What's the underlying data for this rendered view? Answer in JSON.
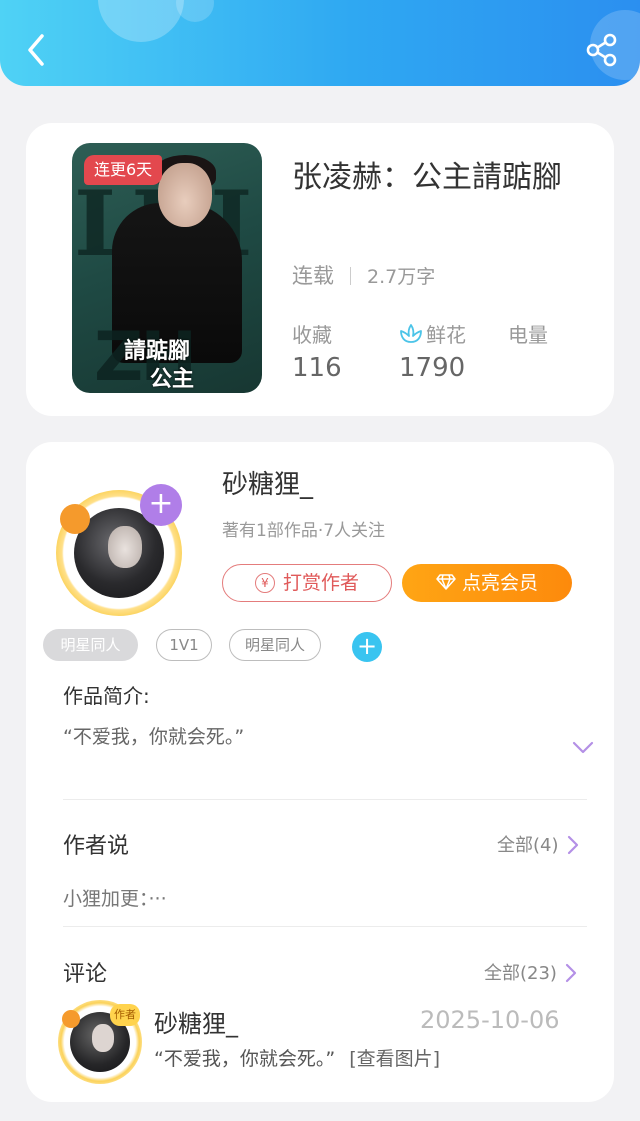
{
  "book": {
    "badge": "连更6天",
    "title": "张凌赫：公主請踮腳",
    "status": "连载",
    "word_count": "2.7万字",
    "cover_title": "請踮腳",
    "cover_subtitle": "公主",
    "stats": [
      {
        "label": "收藏",
        "value": "116"
      },
      {
        "label": "鲜花",
        "value": "1790",
        "icon": "flower-icon"
      },
      {
        "label": "电量",
        "value": ""
      }
    ]
  },
  "author": {
    "name": "砂糖狸_",
    "stats": "著有1部作品·7人关注",
    "tip_button": "打赏作者",
    "tip_icon_text": "¥",
    "vip_button": "点亮会员"
  },
  "tags": [
    "明星同人",
    "1V1",
    "明星同人"
  ],
  "intro": {
    "label": "作品简介:",
    "text": "“不爱我，你就会死。”"
  },
  "author_say": {
    "title": "作者说",
    "more": "全部(4)",
    "text": "小狸加更：···"
  },
  "comments": {
    "title": "评论",
    "more": "全部(23)",
    "items": [
      {
        "name": "砂糖狸_",
        "badge": "作者",
        "date": "2025-10-06",
        "text": "“不爱我，你就会死。”",
        "link": "[查看图片]"
      }
    ]
  },
  "colors": {
    "header_start": "#4fd2f5",
    "header_end": "#2b8ff0",
    "badge_red": "#e3484e",
    "tip_red": "#e05a5a",
    "vip_orange": "#fd8a0c",
    "purple": "#b07ee8",
    "tag_blue": "#39c4f0"
  }
}
